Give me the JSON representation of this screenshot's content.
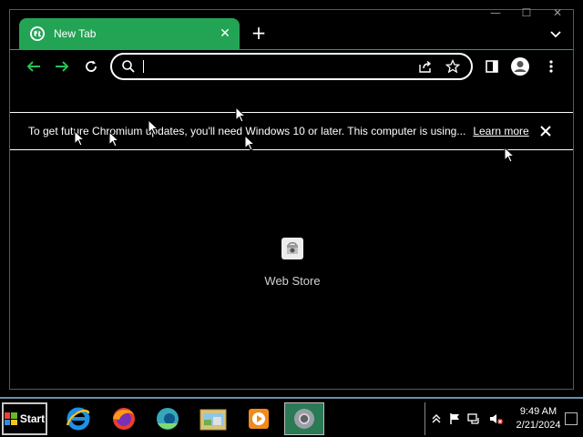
{
  "window": {
    "controls": {
      "minimize": "—",
      "maximize": "☐",
      "close": "✕"
    }
  },
  "tab": {
    "title": "New Tab",
    "close": "✕",
    "favicon": "globe-icon"
  },
  "newtab_label": "+",
  "omnibox": {
    "value": "",
    "placeholder": ""
  },
  "infobar": {
    "message": "To get future Chromium updates, you'll need Windows 10 or later. This computer is using...",
    "link": "Learn more"
  },
  "shortcut": {
    "label": "Web Store",
    "icon": "web-store-icon"
  },
  "taskbar": {
    "start_label": "Start",
    "time": "9:49 AM",
    "date": "2/21/2024",
    "apps": [
      "internet-explorer",
      "firefox",
      "edge",
      "explorer",
      "media-player",
      "chromium"
    ]
  },
  "colors": {
    "accent": "#23a455",
    "background": "#000000",
    "foreground": "#ffffff"
  }
}
